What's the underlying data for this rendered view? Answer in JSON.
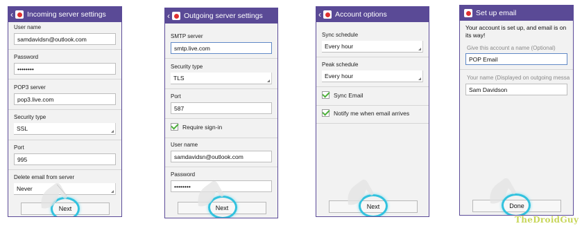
{
  "screens": [
    {
      "title": "Incoming server settings",
      "fields": [
        {
          "label": "User name",
          "value": "samdavidsn@outlook.com"
        },
        {
          "label": "Password",
          "value": "••••••••"
        },
        {
          "label": "POP3 server",
          "value": "pop3.live.com"
        },
        {
          "label": "Security type",
          "value": "SSL"
        },
        {
          "label": "Port",
          "value": "995"
        },
        {
          "label": "Delete email from server",
          "value": "Never"
        }
      ],
      "button": "Next"
    },
    {
      "title": "Outgoing server settings",
      "fields": [
        {
          "label": "SMTP server",
          "value": "smtp.live.com"
        },
        {
          "label": "Security type",
          "value": "TLS"
        },
        {
          "label": "Port",
          "value": "587"
        },
        {
          "label": "User name",
          "value": "samdavidsn@outlook.com"
        },
        {
          "label": "Password",
          "value": "••••••••"
        }
      ],
      "checkbox": "Require sign-in",
      "button": "Next"
    },
    {
      "title": "Account options",
      "fields": [
        {
          "label": "Sync schedule",
          "value": "Every hour"
        },
        {
          "label": "Peak schedule",
          "value": "Every hour"
        }
      ],
      "checkboxes": [
        "Sync Email",
        "Notify me when email arrives"
      ],
      "button": "Next"
    },
    {
      "title": "Set up email",
      "message": "Your account is set up, and email is on its way!",
      "fields": [
        {
          "label": "Give this account a name (Optional)",
          "value": "POP Email"
        },
        {
          "label": "Your name (Displayed on outgoing messa",
          "value": "Sam Davidson"
        }
      ],
      "button": "Done"
    }
  ],
  "watermark": "TheDroidGuy",
  "colors": {
    "titlebar": "#5a4a96",
    "tap_ring": "#32c2de",
    "check": "#4caf3a",
    "watermark": "#c8d65a"
  }
}
